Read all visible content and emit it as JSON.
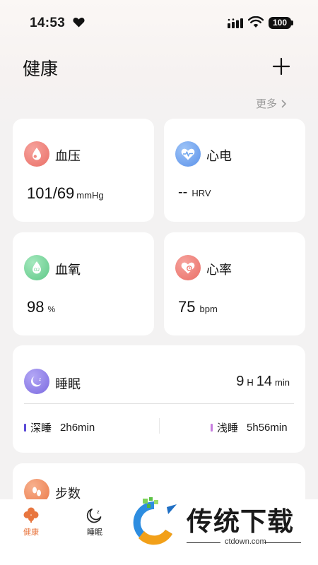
{
  "status_bar": {
    "time": "14:53",
    "battery": "100"
  },
  "header": {
    "title": "健康",
    "more_label": "更多"
  },
  "cards": {
    "blood_pressure": {
      "title": "血压",
      "value": "101/69",
      "unit": "mmHg"
    },
    "ecg": {
      "title": "心电",
      "value": "--",
      "unit": "HRV"
    },
    "blood_oxygen": {
      "title": "血氧",
      "value": "98",
      "unit": "%"
    },
    "heart_rate": {
      "title": "心率",
      "value": "75",
      "unit": "bpm"
    }
  },
  "sleep": {
    "title": "睡眠",
    "hours": "9",
    "hours_unit": "H",
    "minutes": "14",
    "minutes_unit": "min",
    "deep_label": "深睡",
    "deep_value": "2h6min",
    "light_label": "浅睡",
    "light_value": "5h56min"
  },
  "steps": {
    "title": "步数"
  },
  "bottom_nav": {
    "health_label": "健康",
    "sleep_label": "睡眠"
  },
  "watermark": {
    "text": "传统下载",
    "url": "ctdown.com"
  },
  "colors": {
    "accent": "#e8763f",
    "blood_pressure": "#ee7f78",
    "ecg": "#6aa3ee",
    "blood_oxygen": "#6fd093",
    "heart_rate": "#ef7a72",
    "sleep": "#8a7ae6",
    "steps": "#f08a5a",
    "deep_sleep_bar": "#5b4bd6",
    "light_sleep_bar": "#c77ddf"
  },
  "icons": [
    "heart-icon",
    "signal-icon",
    "wifi-icon",
    "plus-icon",
    "chevron-right-icon",
    "blood-drop-icon",
    "ecg-heart-icon",
    "oxygen-drop-icon",
    "heart-rate-icon",
    "moon-icon",
    "steps-icon",
    "clover-icon",
    "moon-outline-icon"
  ]
}
